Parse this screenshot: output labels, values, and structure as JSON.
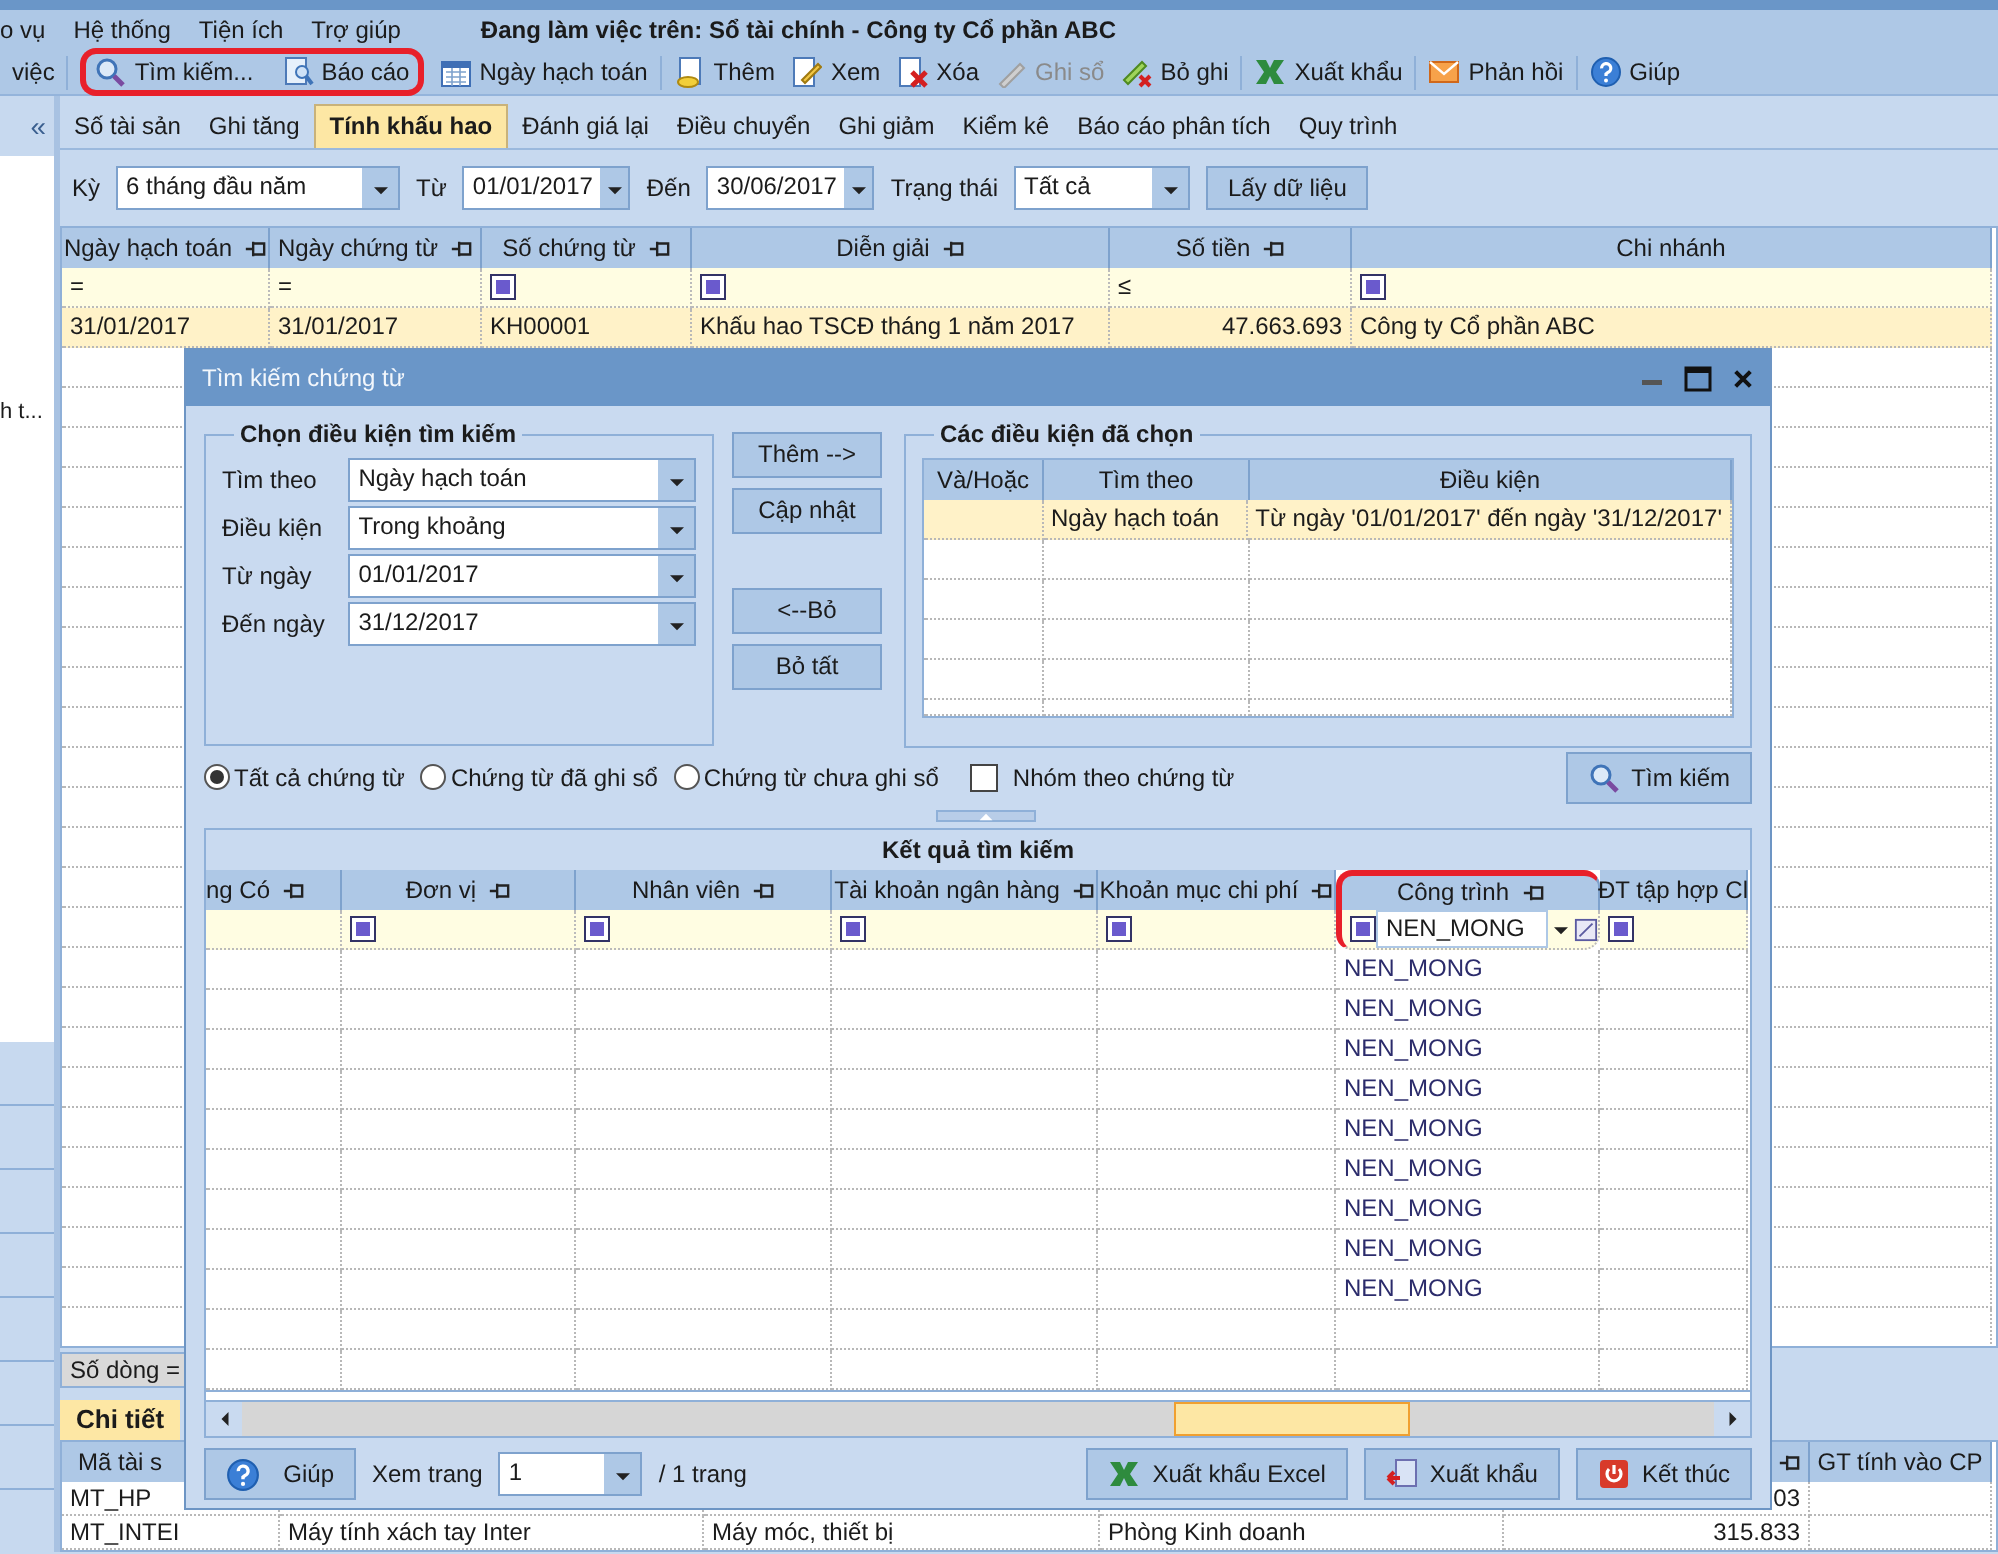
{
  "menu": [
    {
      "label": "o vụ"
    },
    {
      "label": "Hệ thống"
    },
    {
      "label": "Tiện ích"
    },
    {
      "label": "Trợ giúp"
    }
  ],
  "workspace_title": "Đang làm việc trên: Sổ tài chính - Công ty Cổ phần ABC",
  "toolbar_groups": [
    [
      {
        "label": "việc",
        "disabled": false,
        "annotated": false
      }
    ],
    [
      {
        "label": "Tìm kiếm...",
        "disabled": false,
        "annotated": true
      },
      {
        "label": "Báo cáo",
        "disabled": false,
        "annotated": true
      },
      {
        "label": "Ngày hạch toán",
        "disabled": false,
        "annotated": false
      }
    ],
    [
      {
        "label": "Thêm",
        "disabled": false,
        "annotated": false
      },
      {
        "label": "Xem",
        "disabled": false,
        "annotated": false
      },
      {
        "label": "Xóa",
        "disabled": false,
        "annotated": false
      },
      {
        "label": "Ghi sổ",
        "disabled": true,
        "annotated": false
      },
      {
        "label": "Bỏ ghi",
        "disabled": false,
        "annotated": false
      }
    ],
    [
      {
        "label": "Xuất khẩu",
        "disabled": false,
        "annotated": false
      }
    ],
    [
      {
        "label": "Phản hồi",
        "disabled": false,
        "annotated": false
      }
    ],
    [
      {
        "label": "Giúp",
        "disabled": false,
        "annotated": false
      }
    ]
  ],
  "sidebar": {
    "collapse_glyph": "«",
    "items": [
      {
        "label": "h t..."
      }
    ]
  },
  "tabs": [
    {
      "label": "Số tài sản",
      "selected": false
    },
    {
      "label": "Ghi tăng",
      "selected": false
    },
    {
      "label": "Tính khấu hao",
      "selected": true
    },
    {
      "label": "Đánh giá lại",
      "selected": false
    },
    {
      "label": "Điều chuyển",
      "selected": false
    },
    {
      "label": "Ghi giảm",
      "selected": false
    },
    {
      "label": "Kiểm kê",
      "selected": false
    },
    {
      "label": "Báo cáo phân tích",
      "selected": false
    },
    {
      "label": "Quy trình",
      "selected": false
    }
  ],
  "filters": [
    {
      "label": "Kỳ",
      "value": "6 tháng đầu năm"
    },
    {
      "label": "Từ",
      "value": "01/01/2017"
    },
    {
      "label": "Đến",
      "value": "30/06/2017"
    },
    {
      "label": "Trạng thái",
      "value": "Tất cả"
    }
  ],
  "fetch_button": "Lấy dữ liệu",
  "grid": {
    "columns": [
      {
        "label": "Ngày hạch toán",
        "pinned": true
      },
      {
        "label": "Ngày chứng từ",
        "pinned": true
      },
      {
        "label": "Số chứng từ",
        "pinned": true
      },
      {
        "label": "Diễn giải",
        "pinned": true
      },
      {
        "label": "Số tiền",
        "pinned": true
      },
      {
        "label": "Chi nhánh",
        "pinned": false
      }
    ],
    "filter_row": [
      {
        "kind": "operator",
        "text": "="
      },
      {
        "kind": "operator",
        "text": "="
      },
      {
        "kind": "checkbox"
      },
      {
        "kind": "checkbox"
      },
      {
        "kind": "operator",
        "text": "≤"
      },
      {
        "kind": "checkbox"
      }
    ],
    "rows": [
      {
        "selected": true,
        "cells": [
          "31/01/2017",
          "31/01/2017",
          "KH00001",
          "Khấu hao TSCĐ tháng 1 năm 2017",
          "47.663.693",
          "Công ty Cổ phần ABC"
        ]
      }
    ],
    "row_count": "Số dòng ="
  },
  "detail": {
    "tab": "Chi tiết",
    "columns": [
      {
        "label": "Mã tài s",
        "pinned": false
      },
      {},
      {},
      {},
      {
        "pinned": true
      },
      {
        "label": "GT tính vào CP",
        "pinned": false
      }
    ],
    "rows": [
      {
        "column_1": "MT_HP",
        "column_5": "03"
      },
      {
        "column_1": "MT_INTEI",
        "column_2": "Máy tính xách tay Inter",
        "column_3": "Máy móc, thiết bị",
        "column_4": "Phòng Kinh doanh",
        "column_5": "315.833"
      }
    ]
  },
  "dialog": {
    "title": "Tìm kiếm chứng từ",
    "criteria": {
      "title": "Chọn điều kiện tìm kiếm",
      "fields": [
        {
          "label": "Tìm theo",
          "value": "Ngày hạch toán"
        },
        {
          "label": "Điều kiện",
          "value": "Trong khoảng"
        },
        {
          "label": "Từ ngày",
          "value": "01/01/2017"
        },
        {
          "label": "Đến ngày",
          "value": "31/12/2017"
        }
      ]
    },
    "actions": [
      [
        "Thêm -->",
        "Cập nhật"
      ],
      [
        "<--Bỏ",
        "Bỏ tất"
      ]
    ],
    "selected_conditions": {
      "title": "Các điều kiện đã chọn",
      "columns": [
        "Và/Hoặc",
        "Tìm theo",
        "Điều kiện"
      ],
      "rows": [
        {
          "selected": true,
          "search_by": "Ngày hạch toán",
          "condition": "Từ ngày '01/01/2017' đến ngày '31/12/2017'"
        }
      ]
    },
    "scope_options": [
      {
        "label": "Tất cả chứng từ",
        "selected": true
      },
      {
        "label": "Chứng từ đã ghi sổ",
        "selected": false
      },
      {
        "label": "Chứng từ chưa ghi sổ",
        "selected": false
      }
    ],
    "group_by_document": {
      "label": "Nhóm theo chứng từ",
      "checked": false
    },
    "search_button": "Tìm kiếm",
    "results": {
      "title": "Kết quả tìm kiếm",
      "columns": [
        {
          "label": "ng Có",
          "pinned": true,
          "annotated": false,
          "filter": {
            "kind": "none"
          }
        },
        {
          "label": "Đơn vị",
          "pinned": true,
          "annotated": false,
          "filter": {
            "kind": "checkbox"
          }
        },
        {
          "label": "Nhân viên",
          "pinned": true,
          "annotated": false,
          "filter": {
            "kind": "checkbox"
          }
        },
        {
          "label": "Tài khoản ngân hàng",
          "pinned": true,
          "annotated": false,
          "filter": {
            "kind": "checkbox"
          }
        },
        {
          "label": "Khoản mục chi phí",
          "pinned": true,
          "annotated": false,
          "filter": {
            "kind": "checkbox"
          }
        },
        {
          "label": "Công trình",
          "pinned": true,
          "annotated": true,
          "filter": {
            "kind": "editor",
            "value": "NEN_MONG"
          },
          "values": [
            "NEN_MONG",
            "NEN_MONG",
            "NEN_MONG",
            "NEN_MONG",
            "NEN_MONG",
            "NEN_MONG",
            "NEN_MONG",
            "NEN_MONG",
            "NEN_MONG"
          ]
        },
        {
          "label": "ĐT tập hợp Cl",
          "pinned": false,
          "annotated": false,
          "filter": {
            "kind": "checkbox"
          }
        }
      ]
    },
    "footer": {
      "help": "Giúp",
      "page_label": "Xem trang",
      "page": "1",
      "page_total": "/ 1 trang",
      "buttons": [
        "Xuất khẩu Excel",
        "Xuất khẩu",
        "Kết thúc"
      ]
    }
  }
}
